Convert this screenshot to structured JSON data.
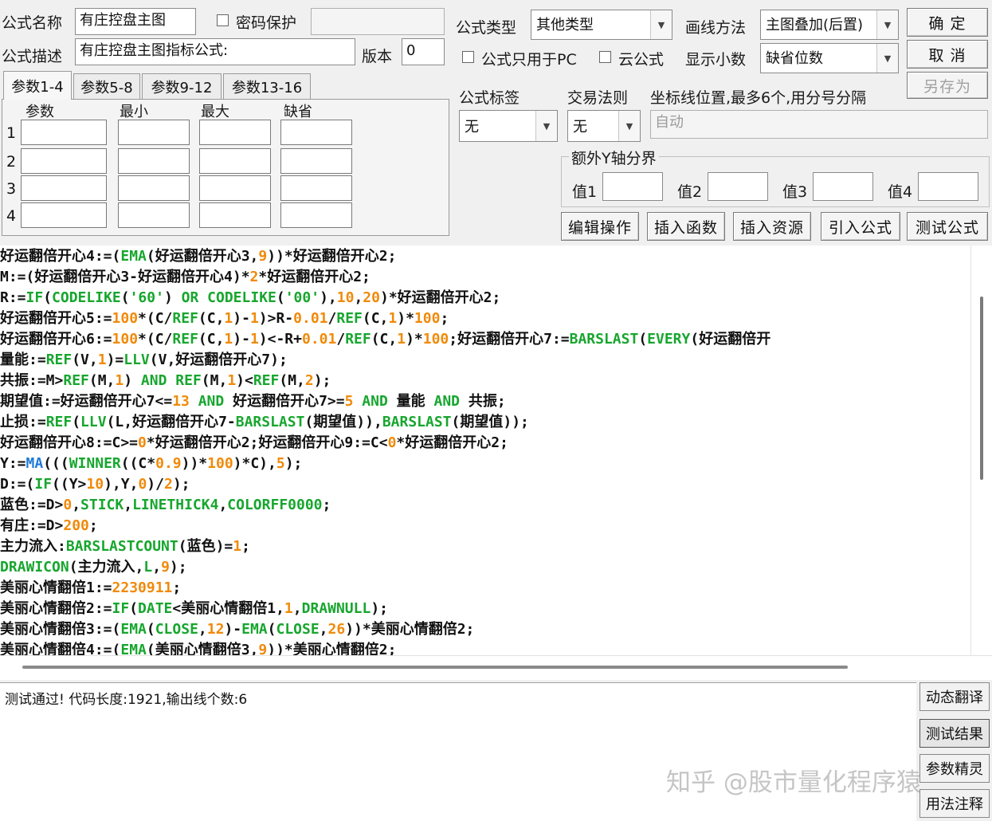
{
  "header": {
    "name_label": "公式名称",
    "name_value": "有庄控盘主图",
    "password_label": "密码保护",
    "password_value": "",
    "desc_label": "公式描述",
    "desc_value": "有庄控盘主图指标公式:",
    "version_label": "版本",
    "version_value": "0",
    "type_label": "公式类型",
    "type_value": "其他类型",
    "draw_label": "画线方法",
    "draw_value": "主图叠加(后置)",
    "pc_only_label": "公式只用于PC",
    "cloud_label": "云公式",
    "decimal_label": "显示小数",
    "decimal_value": "缺省位数"
  },
  "buttons": {
    "ok": "确 定",
    "cancel": "取 消",
    "save_as": "另存为",
    "edit": "编辑操作",
    "insert_func": "插入函数",
    "insert_res": "插入资源",
    "import": "引入公式",
    "test": "测试公式"
  },
  "params": {
    "tabs": [
      "参数1-4",
      "参数5-8",
      "参数9-12",
      "参数13-16"
    ],
    "columns": [
      "参数",
      "最小",
      "最大",
      "缺省"
    ],
    "rows": [
      "1",
      "2",
      "3",
      "4"
    ]
  },
  "options": {
    "tag_label": "公式标签",
    "tag_value": "无",
    "rule_label": "交易法则",
    "rule_value": "无",
    "axis_label": "坐标线位置,最多6个,用分号分隔",
    "axis_value": "自动",
    "yaxis_label": "额外Y轴分界",
    "v1": "值1",
    "v2": "值2",
    "v3": "值3",
    "v4": "值4"
  },
  "code": [
    [
      [
        "w",
        "好运翻倍开心4:=("
      ],
      [
        "k",
        "EMA"
      ],
      [
        "w",
        "(好运翻倍开心3,"
      ],
      [
        "n",
        "9"
      ],
      [
        "w",
        "))*好运翻倍开心2;"
      ]
    ],
    [
      [
        "w",
        "M:=(好运翻倍开心3-好运翻倍开心4)*"
      ],
      [
        "n",
        "2"
      ],
      [
        "w",
        "*好运翻倍开心2;"
      ]
    ],
    [
      [
        "w",
        "R:="
      ],
      [
        "k",
        "IF"
      ],
      [
        "w",
        "("
      ],
      [
        "k",
        "CODELIKE"
      ],
      [
        "w",
        "("
      ],
      [
        "k",
        "'60'"
      ],
      [
        "w",
        ") "
      ],
      [
        "k",
        "OR"
      ],
      [
        "w",
        " "
      ],
      [
        "k",
        "CODELIKE"
      ],
      [
        "w",
        "("
      ],
      [
        "k",
        "'00'"
      ],
      [
        "w",
        "),"
      ],
      [
        "n",
        "10"
      ],
      [
        "w",
        ","
      ],
      [
        "n",
        "20"
      ],
      [
        "w",
        ")*好运翻倍开心2;"
      ]
    ],
    [
      [
        "w",
        "好运翻倍开心5:="
      ],
      [
        "n",
        "100"
      ],
      [
        "w",
        "*(C/"
      ],
      [
        "k",
        "REF"
      ],
      [
        "w",
        "(C,"
      ],
      [
        "n",
        "1"
      ],
      [
        "w",
        ")-"
      ],
      [
        "n",
        "1"
      ],
      [
        "w",
        ")>R-"
      ],
      [
        "n",
        "0.01"
      ],
      [
        "w",
        "/"
      ],
      [
        "k",
        "REF"
      ],
      [
        "w",
        "(C,"
      ],
      [
        "n",
        "1"
      ],
      [
        "w",
        ")*"
      ],
      [
        "n",
        "100"
      ],
      [
        "w",
        ";"
      ]
    ],
    [
      [
        "w",
        "好运翻倍开心6:="
      ],
      [
        "n",
        "100"
      ],
      [
        "w",
        "*(C/"
      ],
      [
        "k",
        "REF"
      ],
      [
        "w",
        "(C,"
      ],
      [
        "n",
        "1"
      ],
      [
        "w",
        ")-"
      ],
      [
        "n",
        "1"
      ],
      [
        "w",
        ")<-R+"
      ],
      [
        "n",
        "0.01"
      ],
      [
        "w",
        "/"
      ],
      [
        "k",
        "REF"
      ],
      [
        "w",
        "(C,"
      ],
      [
        "n",
        "1"
      ],
      [
        "w",
        ")*"
      ],
      [
        "n",
        "100"
      ],
      [
        "w",
        ";好运翻倍开心7:="
      ],
      [
        "k",
        "BARSLAST"
      ],
      [
        "w",
        "("
      ],
      [
        "k",
        "EVERY"
      ],
      [
        "w",
        "(好运翻倍开"
      ]
    ],
    [
      [
        "w",
        "量能:="
      ],
      [
        "k",
        "REF"
      ],
      [
        "w",
        "(V,"
      ],
      [
        "n",
        "1"
      ],
      [
        "w",
        ")="
      ],
      [
        "k",
        "LLV"
      ],
      [
        "w",
        "(V,好运翻倍开心7);"
      ]
    ],
    [
      [
        "w",
        "共振:=M>"
      ],
      [
        "k",
        "REF"
      ],
      [
        "w",
        "(M,"
      ],
      [
        "n",
        "1"
      ],
      [
        "w",
        ") "
      ],
      [
        "k",
        "AND"
      ],
      [
        "w",
        " "
      ],
      [
        "k",
        "REF"
      ],
      [
        "w",
        "(M,"
      ],
      [
        "n",
        "1"
      ],
      [
        "w",
        ")<"
      ],
      [
        "k",
        "REF"
      ],
      [
        "w",
        "(M,"
      ],
      [
        "n",
        "2"
      ],
      [
        "w",
        ");"
      ]
    ],
    [
      [
        "w",
        "期望值:=好运翻倍开心7<="
      ],
      [
        "n",
        "13"
      ],
      [
        "w",
        " "
      ],
      [
        "k",
        "AND"
      ],
      [
        "w",
        " 好运翻倍开心7>="
      ],
      [
        "n",
        "5"
      ],
      [
        "w",
        " "
      ],
      [
        "k",
        "AND"
      ],
      [
        "w",
        " 量能 "
      ],
      [
        "k",
        "AND"
      ],
      [
        "w",
        " 共振;"
      ]
    ],
    [
      [
        "w",
        "止损:="
      ],
      [
        "k",
        "REF"
      ],
      [
        "w",
        "("
      ],
      [
        "k",
        "LLV"
      ],
      [
        "w",
        "(L,好运翻倍开心7-"
      ],
      [
        "k",
        "BARSLAST"
      ],
      [
        "w",
        "(期望值)),"
      ],
      [
        "k",
        "BARSLAST"
      ],
      [
        "w",
        "(期望值));"
      ]
    ],
    [
      [
        "w",
        "好运翻倍开心8:=C>="
      ],
      [
        "n",
        "0"
      ],
      [
        "w",
        "*好运翻倍开心2;好运翻倍开心9:=C<"
      ],
      [
        "n",
        "0"
      ],
      [
        "w",
        "*好运翻倍开心2;"
      ]
    ],
    [
      [
        "w",
        "Y:="
      ],
      [
        "b",
        "MA"
      ],
      [
        "w",
        "((("
      ],
      [
        "k",
        "WINNER"
      ],
      [
        "w",
        "((C*"
      ],
      [
        "n",
        "0.9"
      ],
      [
        "w",
        "))*"
      ],
      [
        "n",
        "100"
      ],
      [
        "w",
        ")*C),"
      ],
      [
        "n",
        "5"
      ],
      [
        "w",
        ");"
      ]
    ],
    [
      [
        "w",
        "D:=("
      ],
      [
        "k",
        "IF"
      ],
      [
        "w",
        "((Y>"
      ],
      [
        "n",
        "10"
      ],
      [
        "w",
        "),Y,"
      ],
      [
        "n",
        "0"
      ],
      [
        "w",
        ")/"
      ],
      [
        "n",
        "2"
      ],
      [
        "w",
        ");"
      ]
    ],
    [
      [
        "w",
        "蓝色:=D>"
      ],
      [
        "n",
        "0"
      ],
      [
        "w",
        ","
      ],
      [
        "k",
        "STICK"
      ],
      [
        "w",
        ","
      ],
      [
        "k",
        "LINETHICK4"
      ],
      [
        "w",
        ","
      ],
      [
        "k",
        "COLORFF0000"
      ],
      [
        "w",
        ";"
      ]
    ],
    [
      [
        "w",
        "有庄:=D>"
      ],
      [
        "n",
        "200"
      ],
      [
        "w",
        ";"
      ]
    ],
    [
      [
        "w",
        "主力流入:"
      ],
      [
        "k",
        "BARSLASTCOUNT"
      ],
      [
        "w",
        "(蓝色)="
      ],
      [
        "n",
        "1"
      ],
      [
        "w",
        ";"
      ]
    ],
    [
      [
        "k",
        "DRAWICON"
      ],
      [
        "w",
        "(主力流入,"
      ],
      [
        "k",
        "L"
      ],
      [
        "w",
        ","
      ],
      [
        "n",
        "9"
      ],
      [
        "w",
        ");"
      ]
    ],
    [
      [
        "w",
        "美丽心情翻倍1:="
      ],
      [
        "n",
        "2230911"
      ],
      [
        "w",
        ";"
      ]
    ],
    [
      [
        "w",
        "美丽心情翻倍2:="
      ],
      [
        "k",
        "IF"
      ],
      [
        "w",
        "("
      ],
      [
        "k",
        "DATE"
      ],
      [
        "w",
        "<美丽心情翻倍1,"
      ],
      [
        "n",
        "1"
      ],
      [
        "w",
        ","
      ],
      [
        "k",
        "DRAWNULL"
      ],
      [
        "w",
        ");"
      ]
    ],
    [
      [
        "w",
        "美丽心情翻倍3:=("
      ],
      [
        "k",
        "EMA"
      ],
      [
        "w",
        "("
      ],
      [
        "k",
        "CLOSE"
      ],
      [
        "w",
        ","
      ],
      [
        "n",
        "12"
      ],
      [
        "w",
        ")-"
      ],
      [
        "k",
        "EMA"
      ],
      [
        "w",
        "("
      ],
      [
        "k",
        "CLOSE"
      ],
      [
        "w",
        ","
      ],
      [
        "n",
        "26"
      ],
      [
        "w",
        "))*美丽心情翻倍2;"
      ]
    ],
    [
      [
        "w",
        "美丽心情翻倍4:=("
      ],
      [
        "k",
        "EMA"
      ],
      [
        "w",
        "(美丽心情翻倍3,"
      ],
      [
        "n",
        "9"
      ],
      [
        "w",
        "))*美丽心情翻倍2;"
      ]
    ]
  ],
  "result": {
    "message": "测试通过! 代码长度:1921,输出线个数:6"
  },
  "side_buttons": [
    "动态翻译",
    "测试结果",
    "参数精灵",
    "用法注释"
  ],
  "watermark": "知乎 @股市量化程序猿"
}
